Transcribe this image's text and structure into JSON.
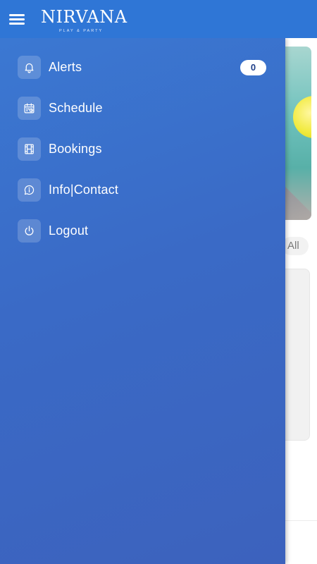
{
  "app": {
    "logo_title": "NIRVANA",
    "logo_subtitle": "PLAY & PARTY"
  },
  "drawer": {
    "items": [
      {
        "label": "Alerts",
        "icon": "bell-icon",
        "badge": "0"
      },
      {
        "label": "Schedule",
        "icon": "calendar-icon"
      },
      {
        "label": "Bookings",
        "icon": "film-icon"
      },
      {
        "label": "Info|Contact",
        "icon": "chat-info-icon"
      },
      {
        "label": "Logout",
        "icon": "power-icon"
      }
    ]
  },
  "background": {
    "see_all_label": "All"
  },
  "colors": {
    "appbar": "#2f76d6",
    "drawer": "#3b6dcc",
    "badge_bg": "#ffffff"
  }
}
